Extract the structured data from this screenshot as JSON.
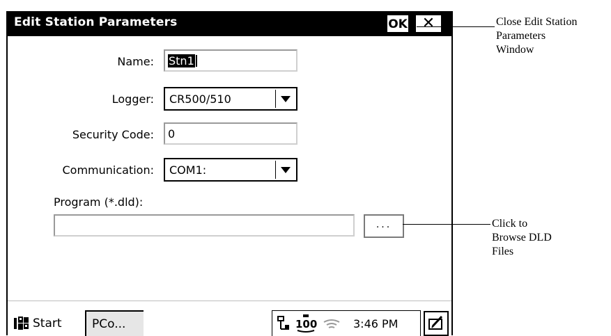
{
  "window": {
    "title": "Edit Station Parameters",
    "ok_label": "OK",
    "close_label": "✕"
  },
  "form": {
    "name": {
      "label": "Name:",
      "value": "Stn1"
    },
    "logger": {
      "label": "Logger:",
      "value": "CR500/510"
    },
    "security_code": {
      "label": "Security Code:",
      "value": "0"
    },
    "communication": {
      "label": "Communication:",
      "value": "COM1:"
    },
    "program": {
      "label": "Program (*.dld):",
      "value": ""
    },
    "browse_label": "..."
  },
  "taskbar": {
    "start_label": "Start",
    "task_label": "PCo...",
    "clock": "3:46 PM",
    "tray_badge": "100"
  },
  "annotations": {
    "close": "Close Edit Station\nParameters\nWindow",
    "browse": "Click to\nBrowse DLD\nFiles"
  },
  "colors": {
    "titlebar": "#000000",
    "window_bg": "#ffffff",
    "task_button_bg": "#e6e6e6"
  }
}
